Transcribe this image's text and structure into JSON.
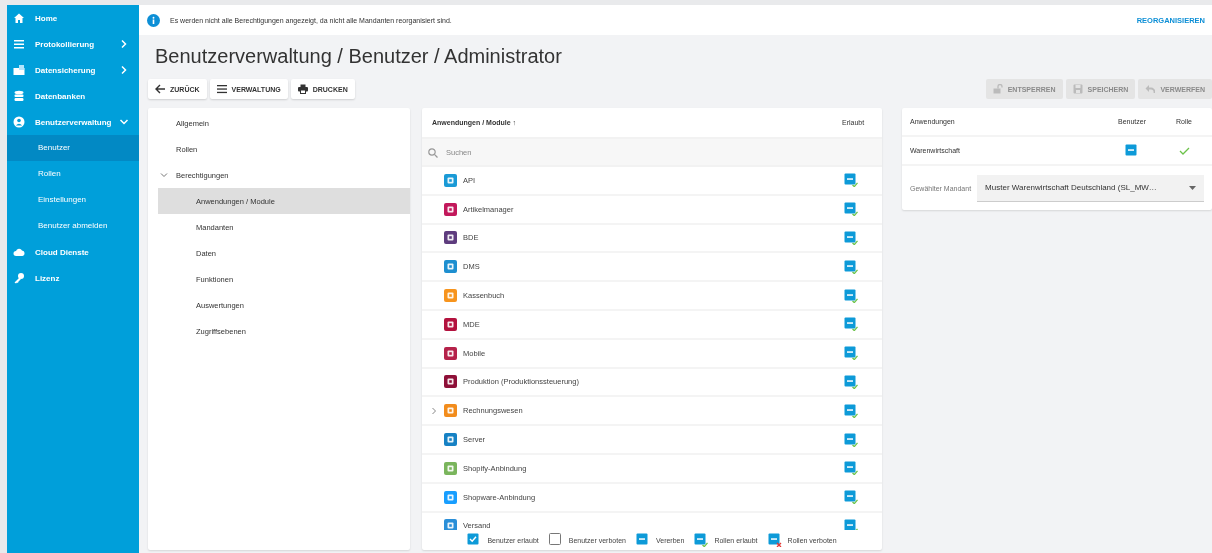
{
  "sidebar": {
    "items": [
      {
        "label": "Home",
        "selected": false
      },
      {
        "label": "Protokollierung",
        "selected": false,
        "expanded": false
      },
      {
        "label": "Datensicherung",
        "selected": false,
        "expanded": false
      },
      {
        "label": "Datenbanken",
        "selected": false
      },
      {
        "label": "Benutzerverwaltung",
        "selected": false,
        "expanded": true,
        "children": [
          {
            "label": "Benutzer",
            "selected": true
          },
          {
            "label": "Rollen",
            "selected": false
          },
          {
            "label": "Einstellungen",
            "selected": false
          },
          {
            "label": "Benutzer abmelden",
            "selected": false
          }
        ]
      },
      {
        "label": "Cloud Dienste",
        "selected": false
      },
      {
        "label": "Lizenz",
        "selected": false
      }
    ]
  },
  "info_bar": {
    "message": "Es werden nicht alle Berechtigungen angezeigt, da nicht alle Mandanten reorganisiert sind.",
    "action": "REORGANISIEREN"
  },
  "title": "Benutzerverwaltung / Benutzer / Administrator",
  "toolbar": {
    "left": [
      {
        "label": "ZURÜCK"
      },
      {
        "label": "VERWALTUNG"
      },
      {
        "label": "DRUCKEN"
      }
    ],
    "right": [
      {
        "label": "ENTSPERREN",
        "disabled": true
      },
      {
        "label": "SPEICHERN",
        "disabled": true
      },
      {
        "label": "VERWERFEN",
        "disabled": true
      }
    ]
  },
  "nav_tree": [
    {
      "label": "Allgemein",
      "selected": false
    },
    {
      "label": "Rollen",
      "selected": false
    },
    {
      "label": "Berechtigungen",
      "selected": false,
      "expanded": true,
      "children": [
        {
          "label": "Anwendungen / Module",
          "selected": true
        },
        {
          "label": "Mandanten",
          "selected": false
        },
        {
          "label": "Daten",
          "selected": false
        },
        {
          "label": "Funktionen",
          "selected": false
        },
        {
          "label": "Auswertungen",
          "selected": false
        },
        {
          "label": "Zugriffsebenen",
          "selected": false
        }
      ]
    }
  ],
  "modules": {
    "columns": [
      "Anwendungen / Module ↑",
      "Erlaubt"
    ],
    "search": {
      "placeholder": "Suchen"
    },
    "rows": [
      {
        "name": "API",
        "color": "#1a9ad6",
        "kind": "role_allowed"
      },
      {
        "name": "Artikelmanager",
        "color": "#c2185b",
        "kind": "role_allowed"
      },
      {
        "name": "BDE",
        "color": "#5e3c7e",
        "kind": "role_allowed"
      },
      {
        "name": "DMS",
        "color": "#1e8fd0",
        "kind": "role_allowed"
      },
      {
        "name": "Kassenbuch",
        "color": "#f7941d",
        "kind": "role_allowed"
      },
      {
        "name": "MDE",
        "color": "#b3123e",
        "kind": "role_allowed"
      },
      {
        "name": "Mobile",
        "color": "#b5224a",
        "kind": "role_allowed"
      },
      {
        "name": "Produktion (Produktionssteuerung)",
        "color": "#8e1038",
        "kind": "role_allowed"
      },
      {
        "name": "Rechnungswesen",
        "color": "#f28c1c",
        "kind": "role_allowed",
        "expanded": false
      },
      {
        "name": "Server",
        "color": "#1681c4",
        "kind": "role_allowed"
      },
      {
        "name": "Shopify-Anbindung",
        "color": "#7ab55c",
        "kind": "role_allowed"
      },
      {
        "name": "Shopware-Anbindung",
        "color": "#189eff",
        "kind": "role_allowed"
      },
      {
        "name": "Versand",
        "color": "#2a8fd8",
        "kind": "role_allowed"
      }
    ],
    "legend": [
      {
        "label": "Benutzer erlaubt",
        "kind": "user_allowed"
      },
      {
        "label": "Benutzer verboten",
        "kind": "user_denied"
      },
      {
        "label": "Vererben",
        "kind": "inherit"
      },
      {
        "label": "Rollen erlaubt",
        "kind": "role_allowed"
      },
      {
        "label": "Rollen verboten",
        "kind": "role_denied"
      }
    ]
  },
  "apps": {
    "columns": [
      "Anwendungen",
      "Benutzer",
      "Rolle"
    ],
    "rows": [
      {
        "name": "Warenwirtschaft",
        "user": {
          "kind": "inherit"
        },
        "role": {
          "kind": "allowed"
        }
      }
    ],
    "mandant": {
      "label": "Gewählter Mandant",
      "value": "Muster Warenwirtschaft Deutschland (SL_MW…"
    }
  }
}
